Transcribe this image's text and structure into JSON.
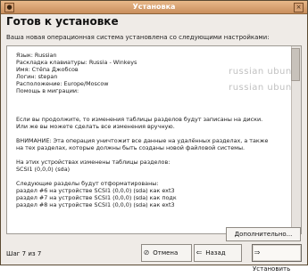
{
  "window": {
    "title": "Установка"
  },
  "main": {
    "heading": "Готов к установке",
    "subtitle": "Ваша новая операционная система установлена со следующими настройками:",
    "summary_lines": [
      "Язык: Russian",
      "Раскладка клавиатуры: Russia - Winkeys",
      "Имя: Стёпа Джобсов",
      "Логин: stepan",
      "Расположение: Europe/Moscow",
      "Помощь в миграции:",
      "",
      "",
      "",
      "Если вы продолжите, то изменения таблицы разделов будут записаны на диски.",
      "Или же вы можете сделать все изменения вручную.",
      "",
      "ВНИМАНИЕ: Эта операция уничтожит все данные на удалённых разделах, а также",
      "на тех разделах, которые должны быть созданы новой файловой системы.",
      "",
      "На этих устройствах изменены таблицы разделов:",
      " SCSI1 (0,0,0) (sda)",
      "",
      "Следующие разделы будут отформатированы:",
      " раздел #6 на устройстве SCSI1 (0,0,0) (sda) как ext3",
      " раздел #7 на устройстве SCSI1 (0,0,0) (sda) как подк",
      " раздел #8 на устройстве SCSI1 (0,0,0) (sda) как ext3"
    ],
    "watermark": [
      "russian ubuntu",
      "russian ubuntu"
    ]
  },
  "buttons": {
    "more": "Дополнительно...",
    "cancel": "Отмена",
    "back": "Назад",
    "install": "Установить"
  },
  "footer": {
    "step": "Шаг 7 из 7"
  }
}
